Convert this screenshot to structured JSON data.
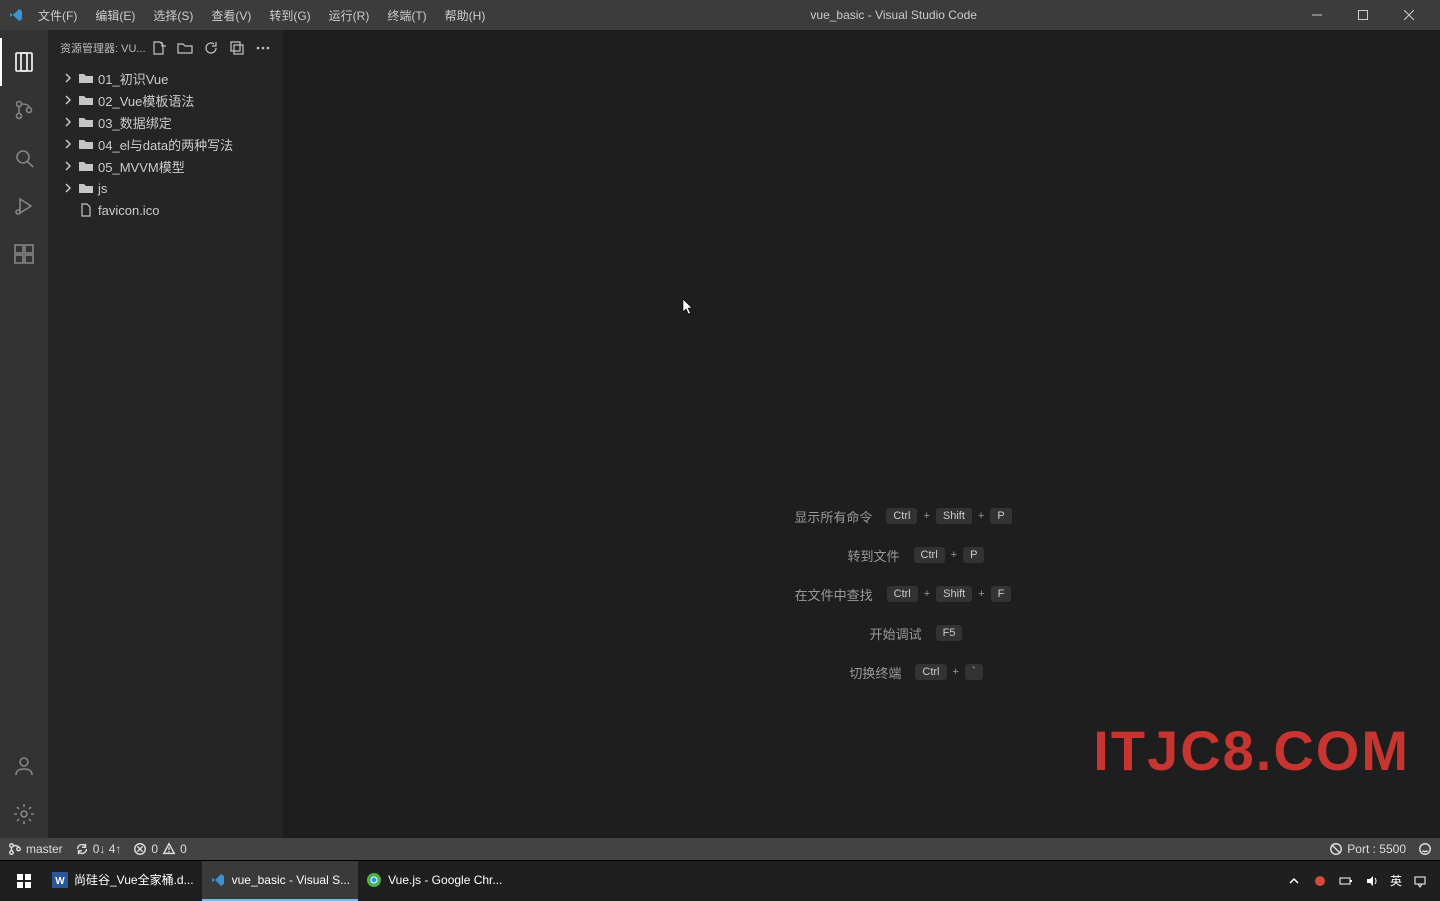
{
  "title": "vue_basic - Visual Studio Code",
  "menus": [
    "文件(F)",
    "编辑(E)",
    "选择(S)",
    "查看(V)",
    "转到(G)",
    "运行(R)",
    "终端(T)",
    "帮助(H)"
  ],
  "sidebar": {
    "header": "资源管理器: VU...",
    "folders": [
      {
        "name": "01_初识Vue"
      },
      {
        "name": "02_Vue模板语法"
      },
      {
        "name": "03_数据绑定"
      },
      {
        "name": "04_el与data的两种写法"
      },
      {
        "name": "05_MVVM模型"
      },
      {
        "name": "js"
      }
    ],
    "files": [
      {
        "name": "favicon.ico"
      }
    ]
  },
  "welcome": {
    "rows": [
      {
        "label": "显示所有命令",
        "keys": [
          "Ctrl",
          "Shift",
          "P"
        ]
      },
      {
        "label": "转到文件",
        "keys": [
          "Ctrl",
          "P"
        ]
      },
      {
        "label": "在文件中查找",
        "keys": [
          "Ctrl",
          "Shift",
          "F"
        ]
      },
      {
        "label": "开始调试",
        "keys": [
          "F5"
        ]
      },
      {
        "label": "切换终端",
        "keys": [
          "Ctrl",
          "`"
        ]
      }
    ]
  },
  "statusbar": {
    "branch": "master",
    "sync": "0↓ 4↑",
    "errors": "0",
    "warnings": "0",
    "port": "Port : 5500"
  },
  "watermark_text": "ITJC8.COM",
  "taskbar": {
    "items": [
      {
        "label": "尚硅谷_Vue全家桶.d...",
        "icon": "word"
      },
      {
        "label": "vue_basic - Visual S...",
        "icon": "vscode",
        "active": true
      },
      {
        "label": "Vue.js - Google Chr...",
        "icon": "chrome"
      }
    ],
    "ime": "英"
  }
}
